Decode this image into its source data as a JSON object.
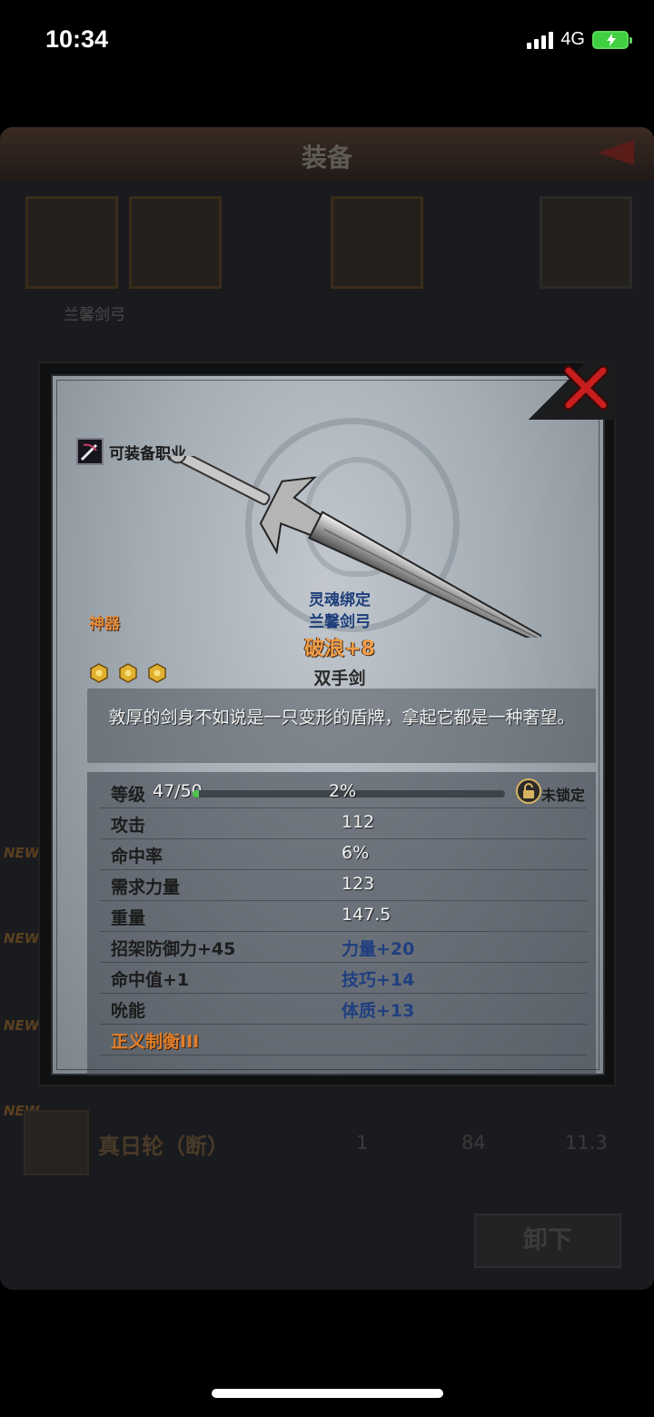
{
  "status_bar": {
    "time": "10:34",
    "network": "4G"
  },
  "background": {
    "title": "装备",
    "owner": "兰馨剑弓",
    "new_badge": "NEW",
    "row": {
      "name": "真日轮（断）",
      "v1": "1",
      "v2": "84",
      "v3": "11.3"
    },
    "unequip_label": "卸下"
  },
  "item": {
    "equip_class_label": "可装备职业",
    "rarity": "神器",
    "binding": "灵魂绑定",
    "owner": "兰馨剑弓",
    "name": "破浪+8",
    "type": "双手剑",
    "star_count": 3,
    "description": "敦厚的剑身不如说是一只变形的盾牌，拿起它都是一种奢望。",
    "level": {
      "label": "等级",
      "value": "47/50",
      "percent_text": "2%",
      "progress": 0.02,
      "lock_text": "未锁定"
    },
    "stats": [
      {
        "left": "攻击",
        "right": "112"
      },
      {
        "left": "命中率",
        "right": "6%"
      },
      {
        "left": "需求力量",
        "right": "123"
      },
      {
        "left": "重量",
        "right": "147.5"
      },
      {
        "left": "招架防御力+45",
        "right": "力量+20"
      },
      {
        "left": "命中值+1",
        "right": "技巧+14"
      },
      {
        "left": "吮能",
        "right": "体质+13"
      },
      {
        "left": "正义制衡III",
        "right": ""
      }
    ]
  },
  "colors": {
    "rarity": "#e08a3a",
    "bonus_blue": "#1f3f80",
    "close_red": "#c81e1e"
  }
}
